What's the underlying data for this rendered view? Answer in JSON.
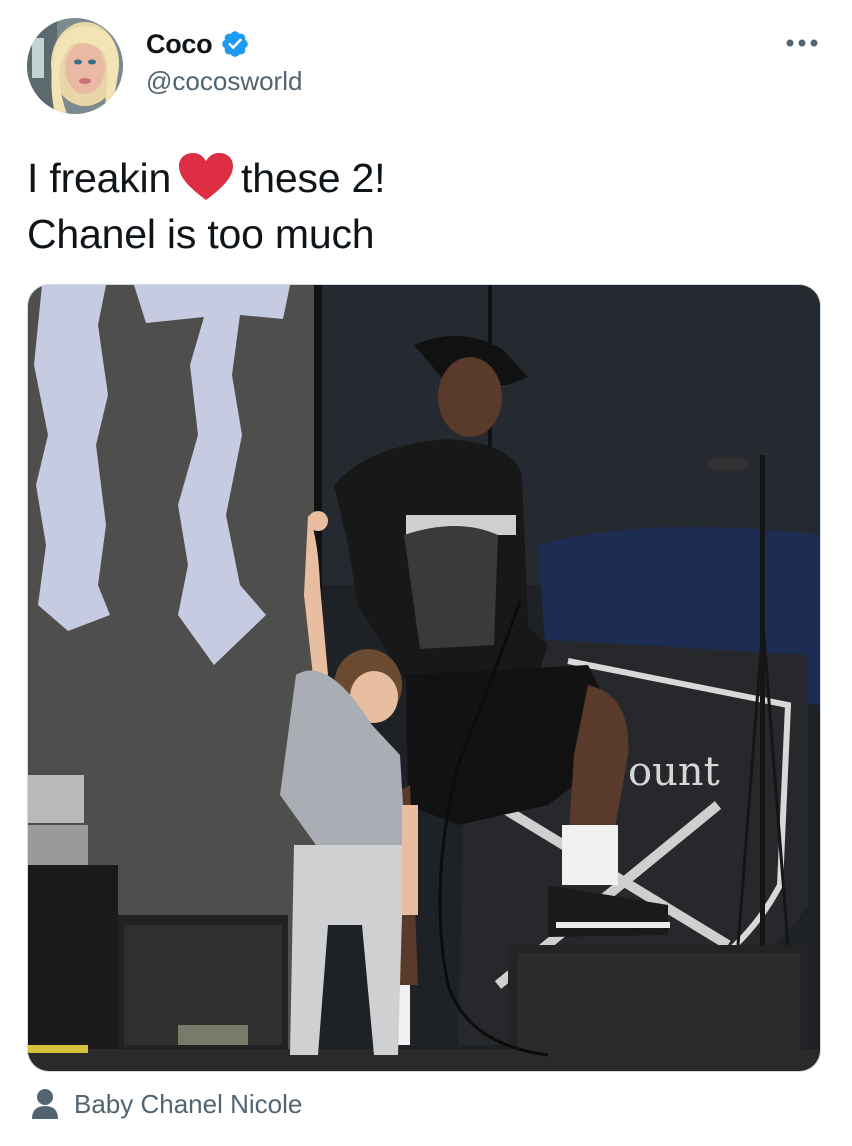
{
  "author": {
    "display_name": "Coco",
    "handle": "@cocosworld",
    "verified": true,
    "avatar_icon": "profile-photo"
  },
  "tweet": {
    "text_before_emoji": "I freakin",
    "emoji": "red-heart",
    "text_after_emoji": "these 2!",
    "line2": "Chanel is too much"
  },
  "media": {
    "type": "photo",
    "banner_text_left": "ount"
  },
  "tagged": {
    "icon": "person-icon",
    "name": "Baby Chanel Nicole"
  },
  "colors": {
    "verified_blue": "#1d9bf0",
    "heart_red": "#dd2e44",
    "secondary_text": "#536471",
    "primary_text": "#0f1419"
  }
}
